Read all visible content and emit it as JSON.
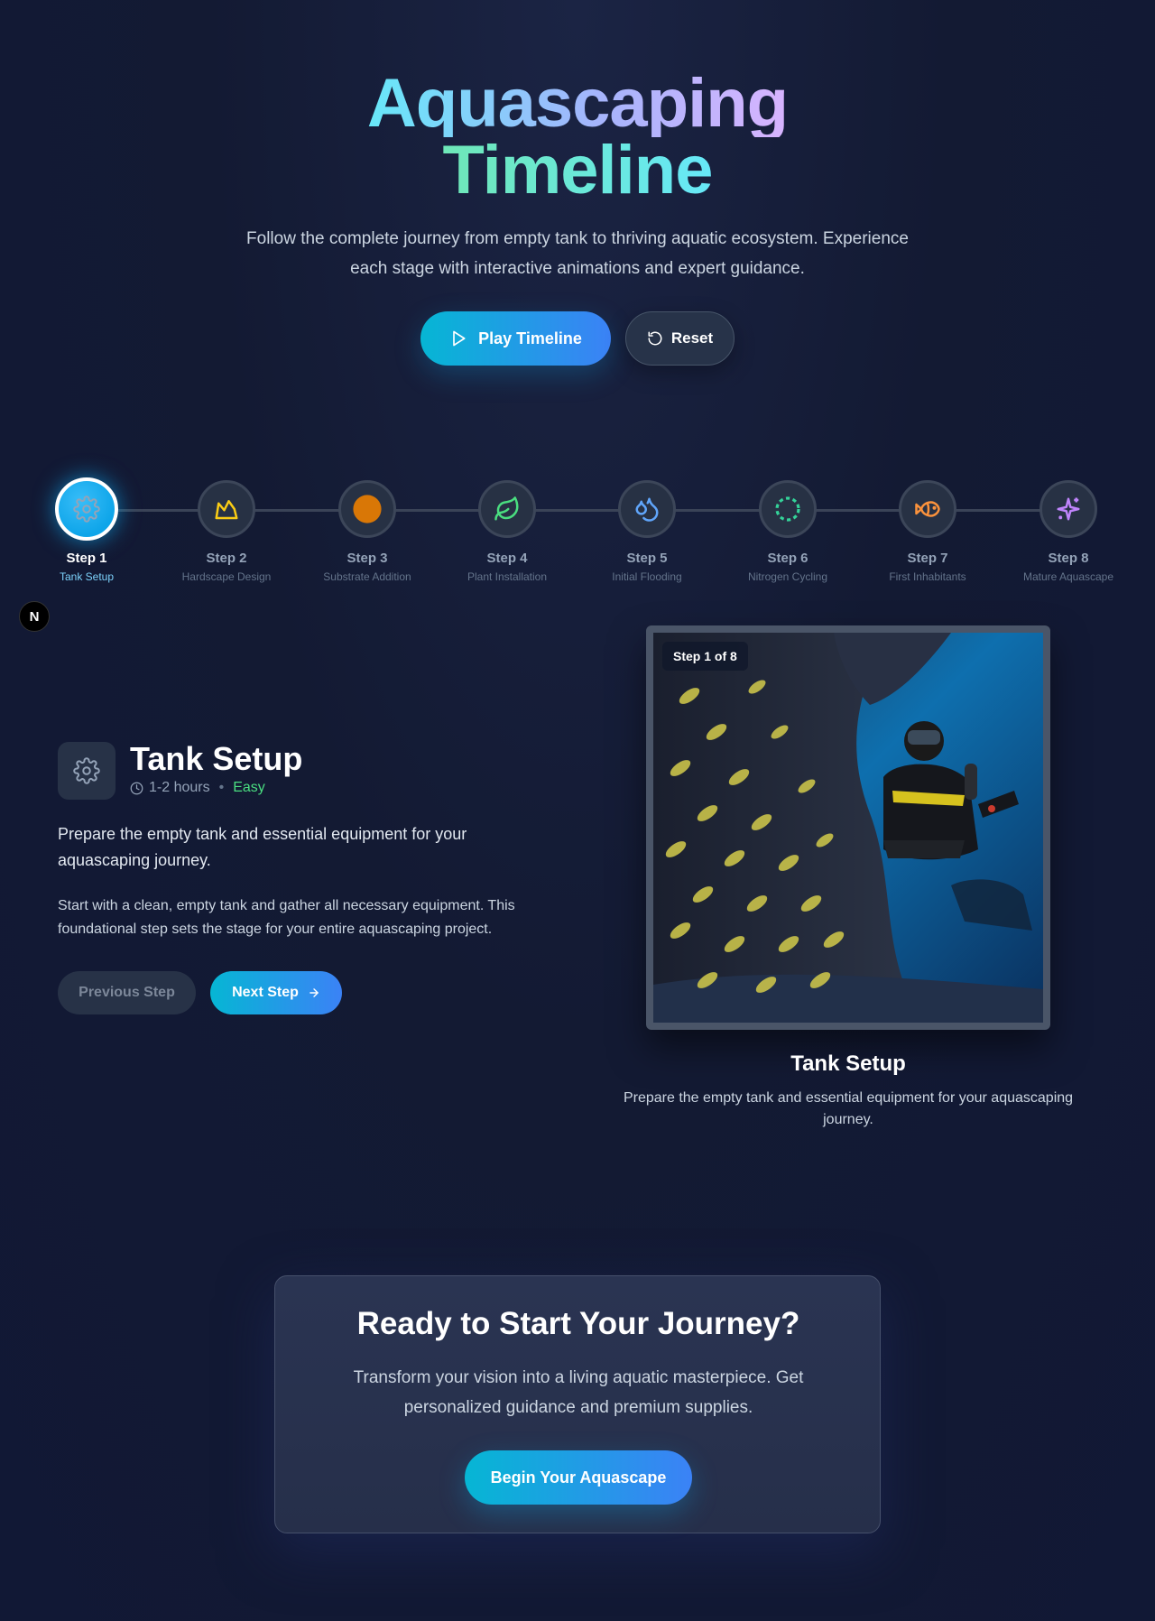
{
  "hero": {
    "title_line1": "Aquascaping",
    "title_line2": "Timeline",
    "subtitle": "Follow the complete journey from empty tank to thriving aquatic ecosystem. Experience each stage with interactive animations and expert guidance.",
    "play_label": "Play Timeline",
    "reset_label": "Reset"
  },
  "timeline": {
    "active_index": 0,
    "steps": [
      {
        "num": "Step 1",
        "name": "Tank Setup",
        "icon": "gear-icon",
        "color": "#94a3b8"
      },
      {
        "num": "Step 2",
        "name": "Hardscape Design",
        "icon": "mountain-icon",
        "color": "#facc15"
      },
      {
        "num": "Step 3",
        "name": "Substrate Addition",
        "icon": "circle-icon",
        "color": "#d97706"
      },
      {
        "num": "Step 4",
        "name": "Plant Installation",
        "icon": "leaf-icon",
        "color": "#4ade80"
      },
      {
        "num": "Step 5",
        "name": "Initial Flooding",
        "icon": "droplets-icon",
        "color": "#60a5fa"
      },
      {
        "num": "Step 6",
        "name": "Nitrogen Cycling",
        "icon": "dashed-circle-icon",
        "color": "#34d399"
      },
      {
        "num": "Step 7",
        "name": "First Inhabitants",
        "icon": "fish-icon",
        "color": "#fb923c"
      },
      {
        "num": "Step 8",
        "name": "Mature Aquascape",
        "icon": "sparkle-icon",
        "color": "#c084fc"
      }
    ]
  },
  "badge": {
    "label": "N"
  },
  "detail": {
    "title": "Tank Setup",
    "duration": "1-2 hours",
    "difficulty": "Easy",
    "lead": "Prepare the empty tank and essential equipment for your aquascaping journey.",
    "body": "Start with a clean, empty tank and gather all necessary equipment. This foundational step sets the stage for your entire aquascaping project.",
    "prev_label": "Previous Step",
    "next_label": "Next Step"
  },
  "preview": {
    "badge": "Step 1 of 8",
    "title": "Tank Setup",
    "description": "Prepare the empty tank and essential equipment for your aquascaping journey."
  },
  "cta": {
    "title": "Ready to Start Your Journey?",
    "text": "Transform your vision into a living aquatic masterpiece. Get personalized guidance and premium supplies.",
    "button": "Begin Your Aquascape"
  },
  "colors": {
    "accent_start": "#06b6d4",
    "accent_end": "#3b82f6",
    "background": "#131a33",
    "easy": "#4ade80"
  }
}
